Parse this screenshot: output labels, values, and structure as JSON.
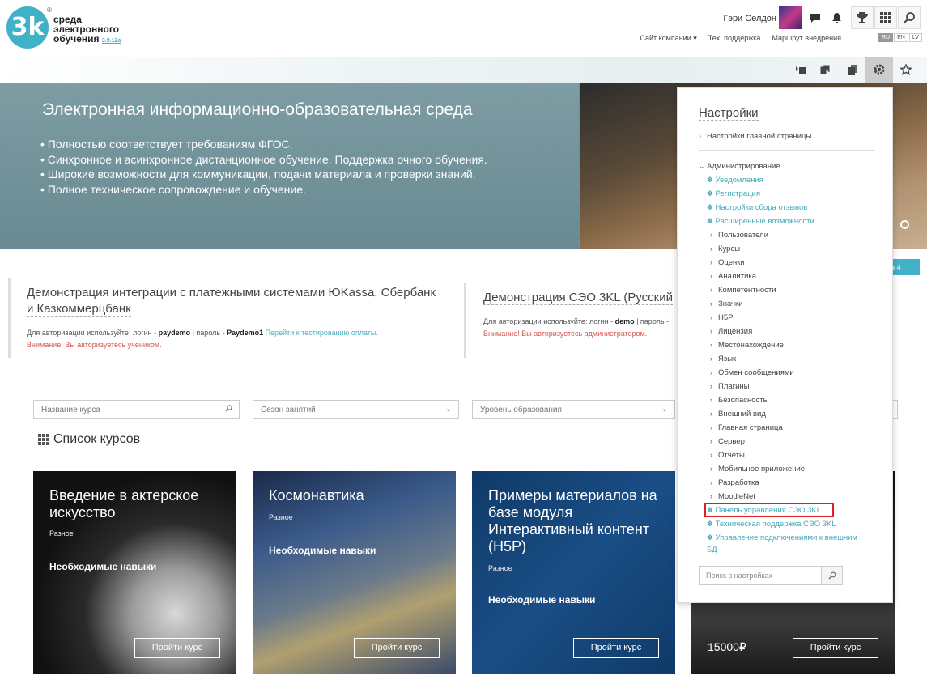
{
  "header": {
    "logo_mark": "3k",
    "logo_line1": "среда",
    "logo_line2": "электронного",
    "logo_line3": "обучения",
    "logo_version": "3.9.12a",
    "logo_reg": "®",
    "user_name": "Гэри Селдон",
    "nav": [
      "Сайт компании ▾",
      "Тех. поддержка",
      "Маршрут внедрения"
    ],
    "languages": [
      "RU",
      "EN",
      "LV"
    ],
    "active_language": "RU"
  },
  "hero": {
    "title": "Электронная информационно-образовательная среда",
    "bullets": [
      "Полностью соответствует требованиям ФГОС.",
      "Синхронное и асинхронное дистанционное обучение. Поддержка очного обучения.",
      "Широкие возможности для коммуникации, подачи материала и проверки знаний.",
      "Полное техническое сопровождение и обучение."
    ]
  },
  "demo1": {
    "title": "Демонстрация интеграции с платежными системами ЮKassa, Сбербанк и Казкоммерцбанк",
    "auth_prefix": "Для авторизации используйте: логин - ",
    "login": "paydemo",
    "pass_prefix": " | пароль - ",
    "password": "Paydemo1",
    "link": " Перейти к тестированию оплаты.",
    "warning": "Внимание! Вы авторизуетесь учеником."
  },
  "demo2": {
    "title": "Демонстрация СЭО 3KL (Русский",
    "auth_prefix": "Для авторизации используйте: логин - ",
    "login": "demo",
    "pass_prefix": " | пароль - ",
    "warning": "Внимание! Вы авторизуетесь администратором."
  },
  "side_tag": "ка 4",
  "filters": {
    "course_name_placeholder": "Название курса",
    "season": "Сезон занятий",
    "level": "Уровень образования"
  },
  "courses_title": "Список курсов",
  "courses": [
    {
      "title": "Введение в актерское искусство",
      "category": "Разное",
      "skills": "Необходимые навыки",
      "button": "Пройти курс"
    },
    {
      "title": "Космонавтика",
      "category": "Разное",
      "skills": "Необходимые навыки",
      "button": "Пройти курс"
    },
    {
      "title": "Примеры материалов на базе модуля Интерактивный контент (H5P)",
      "category": "Разное",
      "skills": "Необходимые навыки",
      "button": "Пройти курс"
    },
    {
      "price": "15000₽",
      "button": "Пройти курс"
    }
  ],
  "settings_menu": {
    "title": "Настройки",
    "front_page_settings": "Настройки главной страницы",
    "admin": "Администрирование",
    "gear_links": [
      "Уведомления",
      "Регистрация",
      "Настройки сбора отзывов",
      "Расширенные возможности"
    ],
    "sections": [
      "Пользователи",
      "Курсы",
      "Оценки",
      "Аналитика",
      "Компетентности",
      "Значки",
      "H5P",
      "Лицензия",
      "Местонахождение",
      "Язык",
      "Обмен сообщениями",
      "Плагины",
      "Безопасность",
      "Внешний вид",
      "Главная страница",
      "Сервер",
      "Отчеты",
      "Мобильное приложение",
      "Разработка",
      "MoodleNet"
    ],
    "bottom_links": [
      "Панель управления СЭО 3KL",
      "Техническая поддержка СЭО 3KL",
      "Управление подключениями к внешним",
      "БД"
    ],
    "search_placeholder": "Поиск в настройках"
  },
  "colors": {
    "accent": "#3fb2c8",
    "warning": "#d9534f",
    "highlight": "#e02020"
  }
}
